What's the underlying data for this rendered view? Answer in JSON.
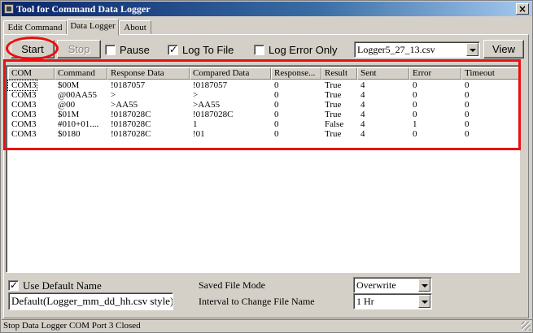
{
  "window": {
    "title": "Tool for Command Data Logger",
    "close_glyph": "×"
  },
  "tabs": [
    {
      "label": "Edit Command"
    },
    {
      "label": "Data Logger"
    },
    {
      "label": "About"
    }
  ],
  "toolbar": {
    "start_label": "Start",
    "stop_label": "Stop",
    "pause_label": "Pause",
    "pause_checked": false,
    "log_to_file_label": "Log To File",
    "log_to_file_checked": true,
    "log_error_only_label": "Log Error Only",
    "log_error_only_checked": false,
    "file_select_value": "Logger5_27_13.csv",
    "view_label": "View"
  },
  "table": {
    "columns": [
      "COM",
      "Command",
      "Response Data",
      "Compared Data",
      "Response...",
      "Result",
      "Sent",
      "Error",
      "Timeout"
    ],
    "rows": [
      [
        "COM3",
        "$00M",
        "!0187057",
        "!0187057",
        "0",
        "True",
        "4",
        "0",
        "0"
      ],
      [
        "COM3",
        "@00AA55",
        ">",
        ">",
        "0",
        "True",
        "4",
        "0",
        "0"
      ],
      [
        "COM3",
        "@00",
        ">AA55",
        ">AA55",
        "0",
        "True",
        "4",
        "0",
        "0"
      ],
      [
        "COM3",
        "$01M",
        "!0187028C",
        "!0187028C",
        "0",
        "True",
        "4",
        "0",
        "0"
      ],
      [
        "COM3",
        "#010+01....",
        "!0187028C",
        "1",
        "0",
        "False",
        "4",
        "1",
        "0"
      ],
      [
        "COM3",
        "$0180",
        "!0187028C",
        "!01",
        "0",
        "True",
        "4",
        "0",
        "0"
      ]
    ]
  },
  "bottom": {
    "use_default_name_label": "Use Default Name",
    "use_default_name_checked": true,
    "default_name_value": "Default(Logger_mm_dd_hh.csv style)",
    "saved_file_mode_label": "Saved File Mode",
    "saved_file_mode_value": "Overwrite",
    "interval_label": "Interval to Change File Name",
    "interval_value": "1 Hr"
  },
  "status": {
    "text": "Stop Data Logger COM Port 3 Closed"
  },
  "colors": {
    "annotation": "#e81010",
    "title_bar": "#0a246a"
  }
}
